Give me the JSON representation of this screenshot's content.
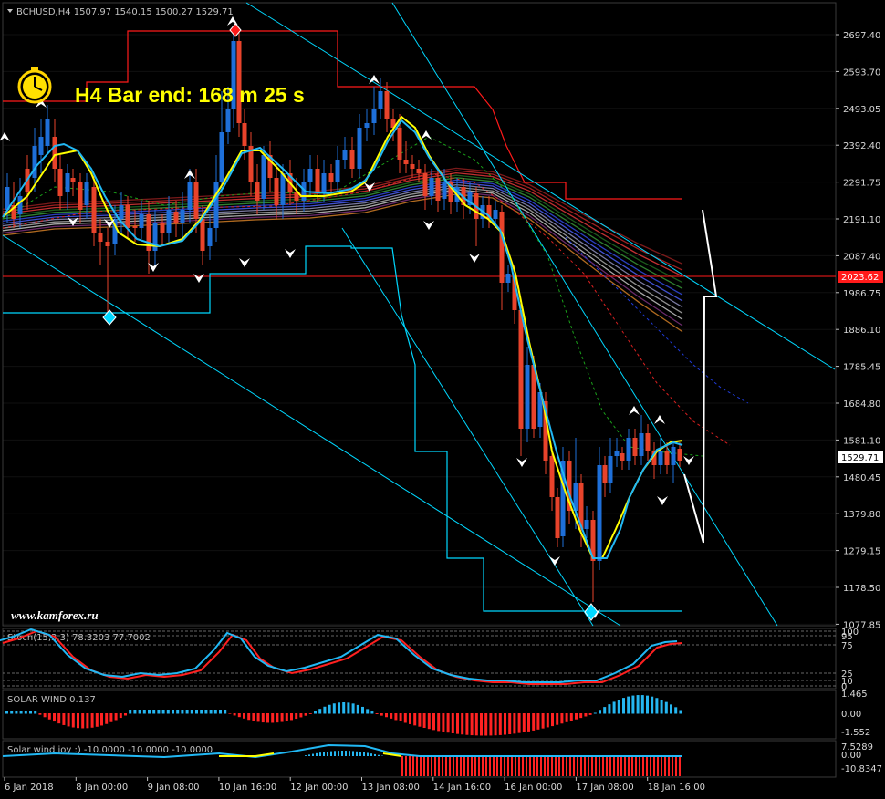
{
  "header": {
    "symbol_line": "BCHUSD,H4  1507.97 1540.15 1500.27 1529.71",
    "bar_end": "H4 Bar end: 168 m 25 s"
  },
  "watermark": "www.kamforex.ru",
  "colors": {
    "background": "#000000",
    "grid": "#1a1a1a",
    "bull": "#1e6fd9",
    "bear": "#e8432b",
    "envelope_red": "#ff1a1a",
    "aqua": "#00d8ff",
    "yellow": "#ffff00",
    "solar_pos": "#25b6f0",
    "solar_neg": "#ff2222"
  },
  "price_axis": {
    "ticks": [
      "2697.40",
      "2593.70",
      "2493.05",
      "2392.40",
      "2291.75",
      "2191.10",
      "2087.40",
      "1986.75",
      "1886.10",
      "1785.45",
      "1684.80",
      "1581.10",
      "1480.45",
      "1379.80",
      "1279.15",
      "1178.50",
      "1077.85"
    ],
    "red_level": "2023.62",
    "current": "1529.71"
  },
  "time_axis": [
    "6 Jan 2018",
    "8 Jan 00:00",
    "9 Jan 08:00",
    "10 Jan 16:00",
    "12 Jan 00:00",
    "13 Jan 08:00",
    "14 Jan 16:00",
    "16 Jan 00:00",
    "17 Jan 08:00",
    "18 Jan 16:00"
  ],
  "indicators": {
    "stoch": {
      "label": "Stoch(15,3,3) 78.3203 77.7002",
      "levels": [
        "100",
        "95",
        "75",
        "25",
        "10",
        "0"
      ]
    },
    "solar_wind": {
      "label": "SOLAR WIND 0.137",
      "levels": [
        "1.465",
        "0.00",
        "-1.552"
      ]
    },
    "solar_joy": {
      "label": "Solar wind joy :) -10.0000 -10.0000 -10.0000",
      "levels": [
        "7.5289",
        "0.00",
        "-10.8347"
      ]
    }
  }
}
